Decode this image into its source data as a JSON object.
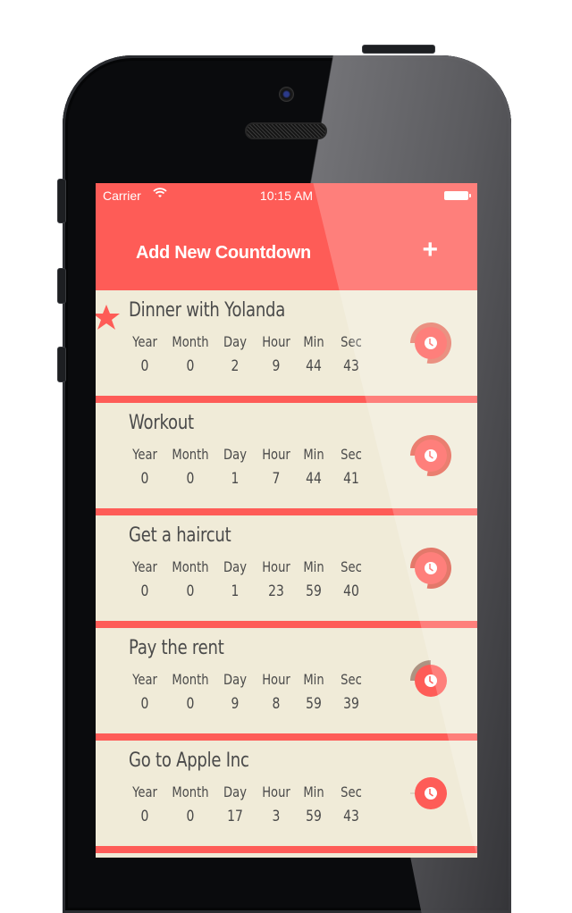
{
  "status_bar": {
    "carrier": "Carrier",
    "wifi_icon": "wifi-icon",
    "time": "10:15 AM",
    "battery_icon": "battery-icon"
  },
  "nav": {
    "title": "Add New Countdown",
    "add_icon": "plus-icon",
    "add_label": "+"
  },
  "colors": {
    "accent": "#fe5c57",
    "card_bg": "#f0ebd8",
    "text": "#4a4a4a",
    "ring_dark": "#e4725f",
    "ring_tan": "#ad9382"
  },
  "unit_labels": [
    "Year",
    "Month",
    "Day",
    "Hour",
    "Min",
    "Sec"
  ],
  "countdowns": [
    {
      "title": "Dinner with Yolanda",
      "favorite": true,
      "values": [
        "0",
        "0",
        "2",
        "9",
        "44",
        "43"
      ],
      "progress": 0.78,
      "ring_color": "#e4725f"
    },
    {
      "title": "Workout",
      "favorite": false,
      "values": [
        "0",
        "0",
        "1",
        "7",
        "44",
        "41"
      ],
      "progress": 0.78,
      "ring_color": "#e45a48"
    },
    {
      "title": "Get a haircut",
      "favorite": false,
      "values": [
        "0",
        "0",
        "1",
        "23",
        "59",
        "40"
      ],
      "progress": 0.78,
      "ring_color": "#db5340"
    },
    {
      "title": "Pay the rent",
      "favorite": false,
      "values": [
        "0",
        "0",
        "9",
        "8",
        "59",
        "39"
      ],
      "progress": 0.25,
      "ring_color": "#ad9382"
    },
    {
      "title": "Go to Apple Inc",
      "favorite": false,
      "values": [
        "0",
        "0",
        "17",
        "3",
        "59",
        "43"
      ],
      "progress": 0.0,
      "ring_color": "#c9c0ad"
    }
  ]
}
